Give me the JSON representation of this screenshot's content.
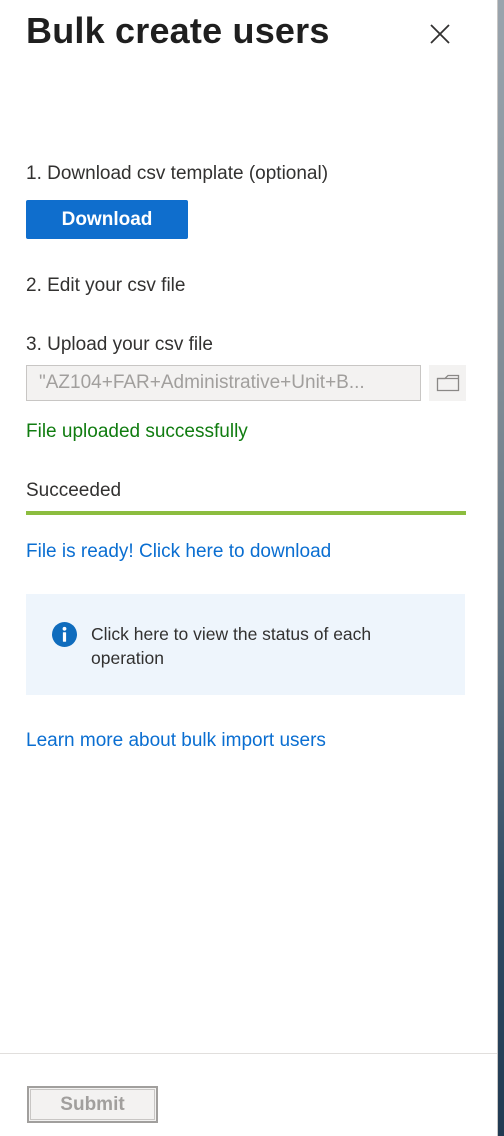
{
  "header": {
    "title": "Bulk create users",
    "close_icon": "close-icon"
  },
  "steps": {
    "step1_label": "1. Download csv template (optional)",
    "download_button": "Download",
    "step2_label": "2. Edit your csv file",
    "step3_label": "3. Upload your csv file",
    "file_value": "\"AZ104+FAR+Administrative+Unit+B...",
    "folder_icon": "folder-icon",
    "upload_status": "File uploaded successfully"
  },
  "progress": {
    "label": "Succeeded",
    "percent": 100,
    "color": "#8cbd3f"
  },
  "links": {
    "download_result": "File is ready! Click here to download",
    "learn_more": "Learn more about bulk import users"
  },
  "info": {
    "icon": "info-icon",
    "text": "Click here to view the status of each operation"
  },
  "footer": {
    "submit_button": "Submit"
  },
  "colors": {
    "accent": "#0f6ecd",
    "success": "#107c10",
    "link": "#0a6ed1",
    "info_bg": "#eef5fc"
  }
}
